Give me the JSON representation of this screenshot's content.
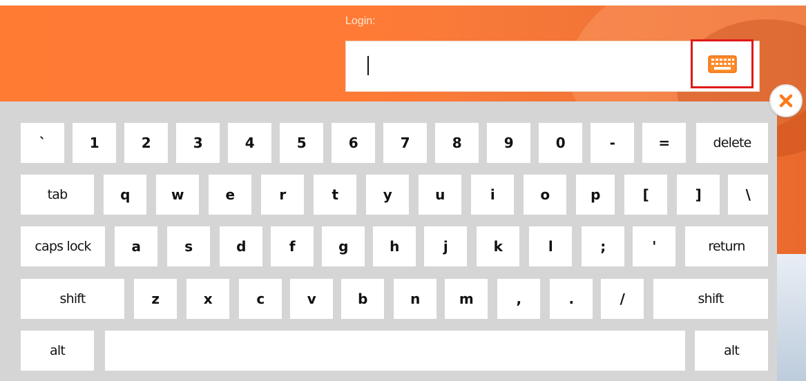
{
  "login": {
    "label": "Login:",
    "value": ""
  },
  "icons": {
    "keyboard_toggle": "keyboard-icon",
    "close": "close-icon"
  },
  "colors": {
    "accent_orange": "#ff7a33",
    "highlight_red": "#e01818",
    "keyboard_bg": "#d5d5d5",
    "key_bg": "#ffffff"
  },
  "keyboard": {
    "row1": [
      "`",
      "1",
      "2",
      "3",
      "4",
      "5",
      "6",
      "7",
      "8",
      "9",
      "0",
      "-",
      "=",
      "delete"
    ],
    "row2": [
      "tab",
      "q",
      "w",
      "e",
      "r",
      "t",
      "y",
      "u",
      "i",
      "o",
      "p",
      "[",
      "]",
      "\\"
    ],
    "row3": [
      "caps lock",
      "a",
      "s",
      "d",
      "f",
      "g",
      "h",
      "j",
      "k",
      "l",
      ";",
      "'",
      "return"
    ],
    "row4": [
      "shift",
      "z",
      "x",
      "c",
      "v",
      "b",
      "n",
      "m",
      ",",
      ".",
      "/",
      "shift"
    ],
    "row5": [
      "alt",
      "",
      "alt"
    ]
  }
}
